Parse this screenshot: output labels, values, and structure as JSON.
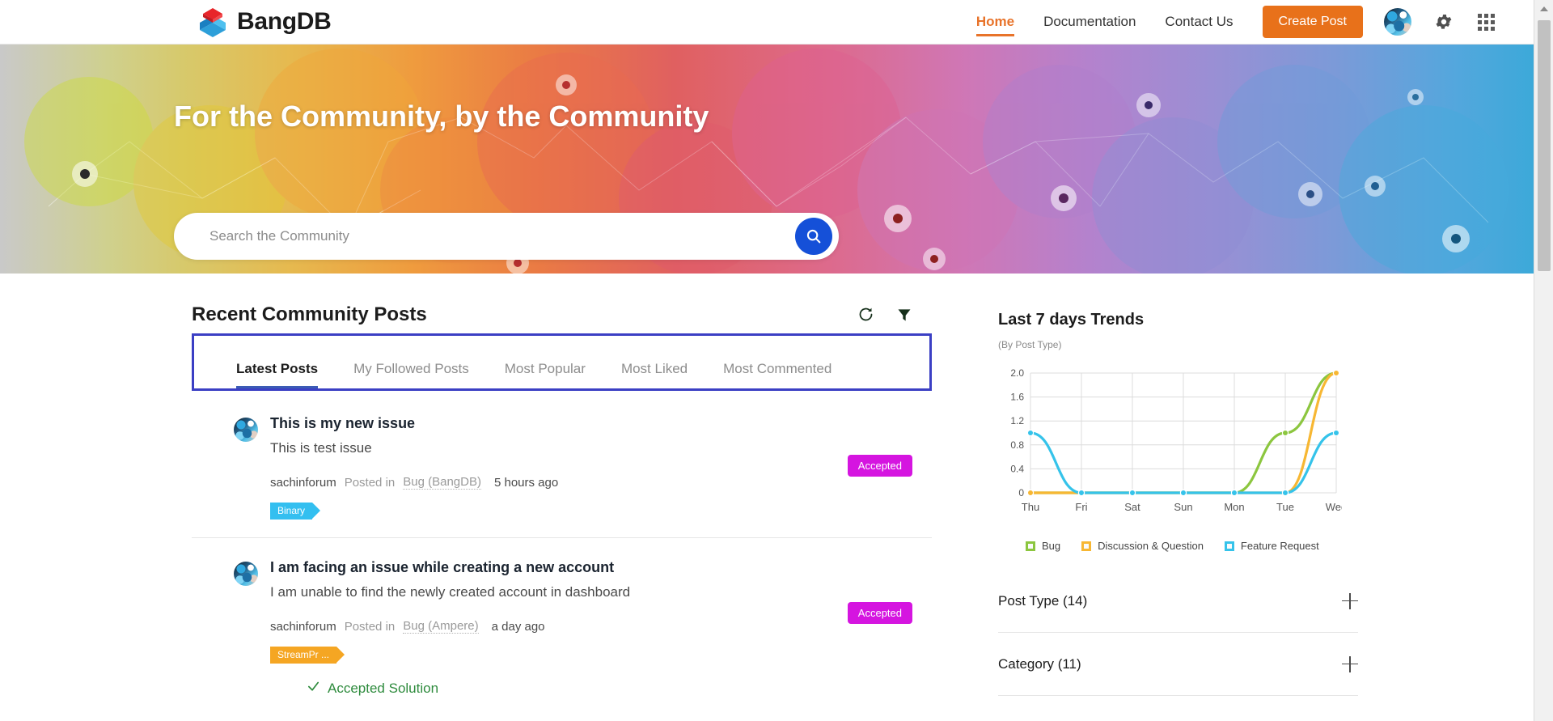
{
  "header": {
    "brand": "BangDB",
    "nav": [
      {
        "label": "Home",
        "active": true
      },
      {
        "label": "Documentation",
        "active": false
      },
      {
        "label": "Contact Us",
        "active": false
      }
    ],
    "create_post_label": "Create Post",
    "accent_color": "#e8711a"
  },
  "hero": {
    "title": "For the Community, by the Community",
    "search_placeholder": "Search the Community",
    "search_value": "",
    "search_button_color": "#1550d8"
  },
  "posts_panel": {
    "title": "Recent Community Posts",
    "tabs": [
      {
        "label": "Latest Posts",
        "active": true
      },
      {
        "label": "My Followed Posts",
        "active": false
      },
      {
        "label": "Most Popular",
        "active": false
      },
      {
        "label": "Most Liked",
        "active": false
      },
      {
        "label": "Most Commented",
        "active": false
      }
    ],
    "highlight_color": "#3b3fc4",
    "posts": [
      {
        "title": "This is my new issue",
        "description": "This is test issue",
        "author": "sachinforum",
        "posted_in_label": "Posted in",
        "category": "Bug (BangDB)",
        "time": "5 hours ago",
        "tag": "Binary",
        "tag_color": "#33bff0",
        "badge": "Accepted",
        "badge_color": "#d515e0",
        "accepted_solution": ""
      },
      {
        "title": "I am facing an issue while creating a new account",
        "description": "I am unable to find the newly created account in dashboard",
        "author": "sachinforum",
        "posted_in_label": "Posted in",
        "category": "Bug (Ampere)",
        "time": "a day ago",
        "tag": "StreamPr ...",
        "tag_color": "#f5a623",
        "badge": "Accepted",
        "badge_color": "#d515e0",
        "accepted_solution": "Accepted Solution"
      }
    ]
  },
  "trends": {
    "title": "Last 7 days Trends",
    "subtitle": "(By Post Type)"
  },
  "filters": [
    {
      "label": "Post Type (14)"
    },
    {
      "label": "Category (11)"
    }
  ],
  "chart_data": {
    "type": "line",
    "title": "Last 7 days Trends",
    "subtitle": "(By Post Type)",
    "x": [
      "Thu",
      "Fri",
      "Sat",
      "Sun",
      "Mon",
      "Tue",
      "Wed"
    ],
    "xlabel": "",
    "ylabel": "",
    "ylim": [
      0,
      2.0
    ],
    "yticks": [
      0,
      0.4,
      0.8,
      1.2,
      1.6,
      2.0
    ],
    "ytick_labels": [
      "0",
      "0.4",
      "0.8",
      "1.2",
      "1.6",
      "2.0"
    ],
    "grid": true,
    "legend_position": "bottom",
    "series": [
      {
        "name": "Bug",
        "color": "#8cc63f",
        "values": [
          0,
          0,
          0,
          0,
          0,
          1,
          2
        ]
      },
      {
        "name": "Discussion & Question",
        "color": "#f7b733",
        "values": [
          0,
          0,
          0,
          0,
          0,
          0,
          2
        ]
      },
      {
        "name": "Feature Request",
        "color": "#35c3ea",
        "values": [
          1,
          0,
          0,
          0,
          0,
          0,
          1
        ]
      }
    ]
  }
}
